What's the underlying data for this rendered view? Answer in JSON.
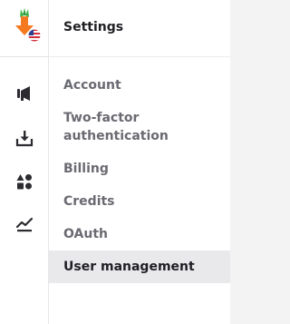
{
  "brand": {
    "logo_icon": "carrot-download-logo-icon",
    "flag_icon": "us-flag-icon",
    "accent_color": "#f5791f",
    "leaf_color": "#3bb54a"
  },
  "rail": {
    "items": [
      {
        "icon": "megaphone-icon"
      },
      {
        "icon": "inbox-download-icon"
      },
      {
        "icon": "shapes-icon"
      },
      {
        "icon": "trend-chart-icon"
      }
    ]
  },
  "settings": {
    "title": "Settings",
    "items": [
      {
        "label": "Account",
        "active": false
      },
      {
        "label": "Two-factor authentication",
        "active": false
      },
      {
        "label": "Billing",
        "active": false
      },
      {
        "label": "Credits",
        "active": false
      },
      {
        "label": "OAuth",
        "active": false
      },
      {
        "label": "User management",
        "active": true
      }
    ]
  }
}
